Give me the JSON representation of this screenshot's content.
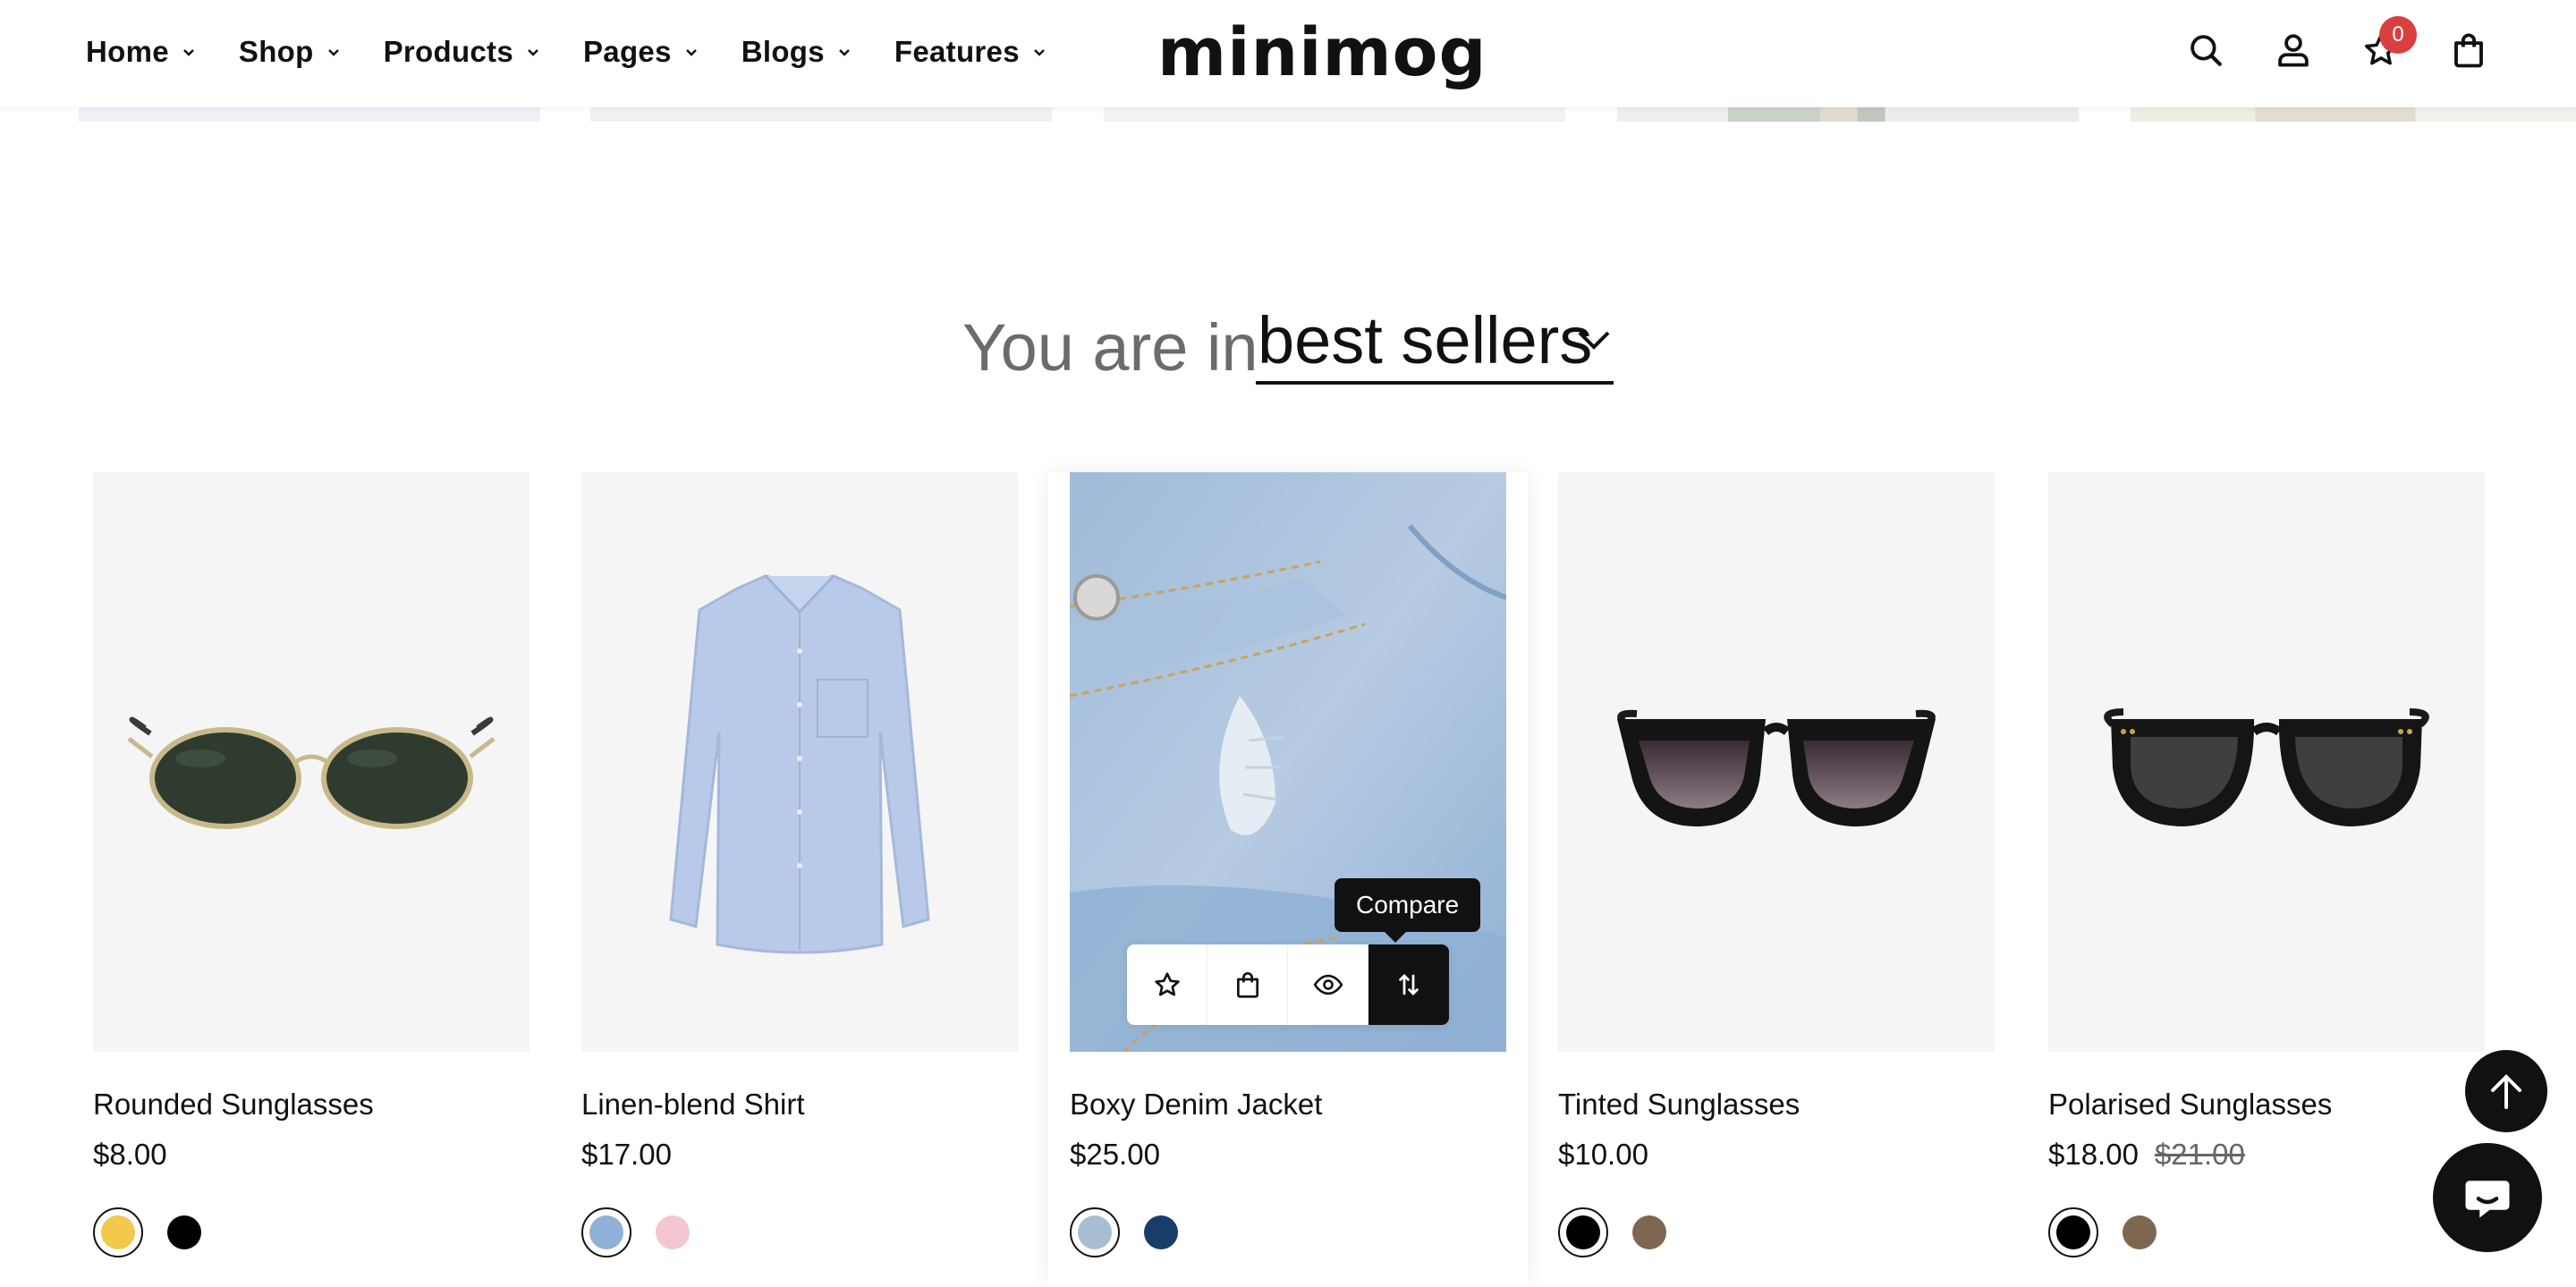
{
  "header": {
    "logo": "minimog",
    "nav": [
      "Home",
      "Shop",
      "Products",
      "Pages",
      "Blogs",
      "Features"
    ],
    "wishlist_count": "0"
  },
  "section": {
    "prefix": "You are in",
    "collection": "best sellers"
  },
  "products": [
    {
      "title": "Rounded Sunglasses",
      "price": "$8.00",
      "swatches": [
        "#f2c94c",
        "#000000"
      ]
    },
    {
      "title": "Linen-blend Shirt",
      "price": "$17.00",
      "swatches": [
        "#8fb0d8",
        "#f5c6d1"
      ]
    },
    {
      "title": "Boxy Denim Jacket",
      "price": "$25.00",
      "swatches": [
        "#a9bdd2",
        "#173e69"
      ]
    },
    {
      "title": "Tinted Sunglasses",
      "price": "$10.00",
      "swatches": [
        "#000000",
        "#7d6750"
      ]
    },
    {
      "title": "Polarised Sunglasses",
      "price": "$18.00",
      "compare_price": "$21.00",
      "swatches": [
        "#000000",
        "#7d6750"
      ]
    }
  ],
  "hover_actions": {
    "tooltip": "Compare",
    "icons": [
      "star-icon",
      "bag-icon",
      "eye-icon",
      "compare-icon"
    ]
  },
  "colors": {
    "accent": "#111111",
    "badge": "#da3f3f",
    "image_bg": "#f5f5f5"
  }
}
